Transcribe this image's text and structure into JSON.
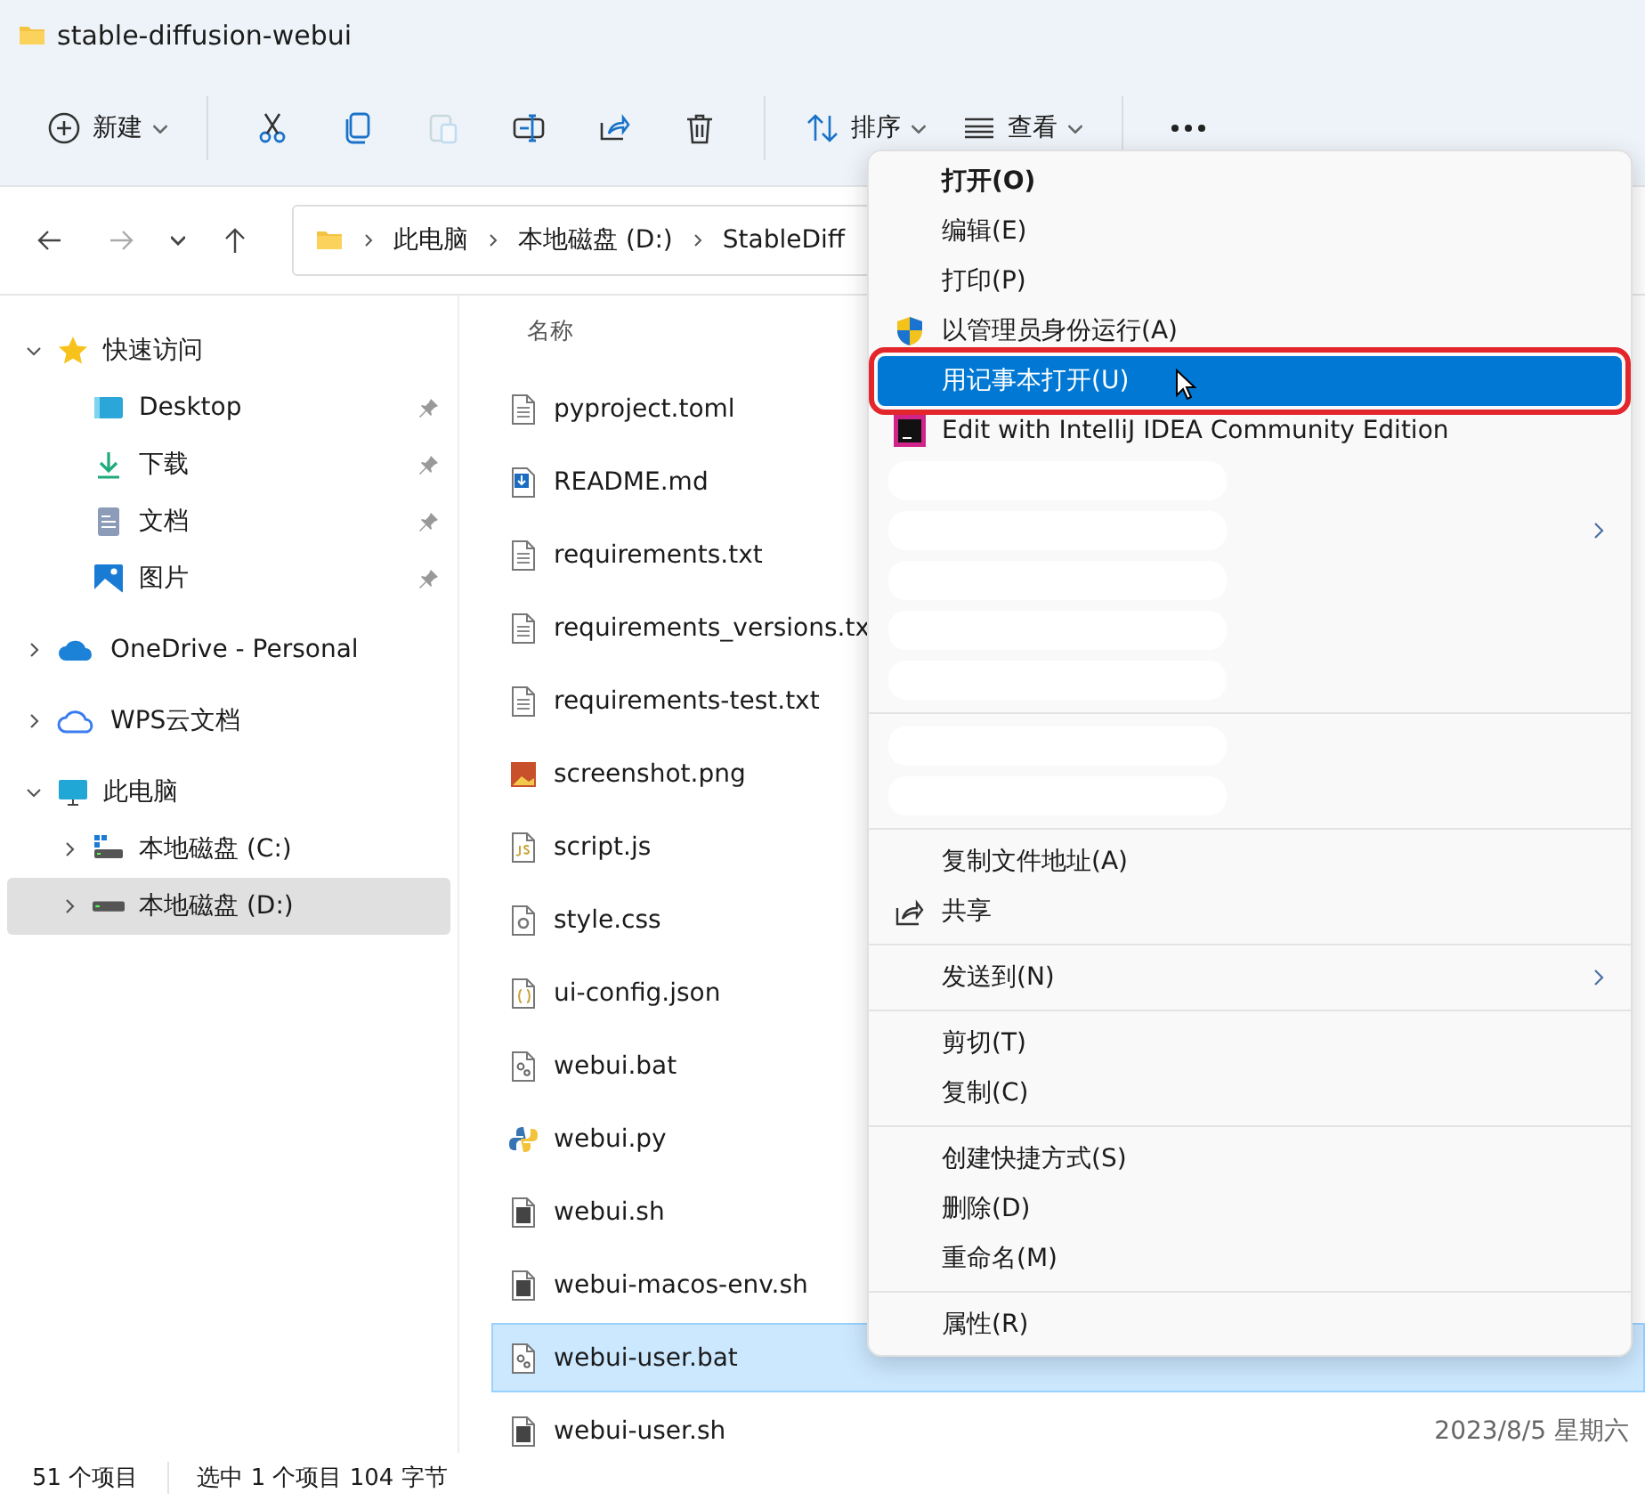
{
  "window": {
    "title": "stable-diffusion-webui"
  },
  "toolbar": {
    "items": [
      {
        "kind": "new",
        "label": "新建",
        "disabled": false
      },
      {
        "kind": "cut",
        "disabled": false
      },
      {
        "kind": "copy",
        "disabled": false
      },
      {
        "kind": "paste",
        "disabled": true
      },
      {
        "kind": "rename",
        "disabled": false
      },
      {
        "kind": "share",
        "disabled": false
      },
      {
        "kind": "delete",
        "disabled": false
      },
      {
        "kind": "sort",
        "label": "排序",
        "disabled": false
      },
      {
        "kind": "view",
        "label": "查看",
        "disabled": false
      },
      {
        "kind": "more",
        "disabled": false
      }
    ]
  },
  "navigation": {
    "back_disabled": false,
    "forward_disabled": true
  },
  "address": {
    "crumbs": [
      "此电脑",
      "本地磁盘 (D:)",
      "StableDiff"
    ]
  },
  "sidebar": {
    "items": [
      {
        "label": "快速访问",
        "kind": "star",
        "expanded": true,
        "selected": false,
        "children": [
          {
            "label": "Desktop",
            "kind": "desktop",
            "pinned": true,
            "selected": false
          },
          {
            "label": "下载",
            "kind": "download",
            "pinned": true,
            "selected": false
          },
          {
            "label": "文档",
            "kind": "document",
            "pinned": true,
            "selected": false
          },
          {
            "label": "图片",
            "kind": "pictures",
            "pinned": true,
            "selected": false
          }
        ]
      },
      {
        "label": "OneDrive - Personal",
        "kind": "onedrive",
        "expanded": false,
        "selected": false
      },
      {
        "label": "WPS云文档",
        "kind": "cloud",
        "expanded": false,
        "selected": false
      },
      {
        "label": "此电脑",
        "kind": "pc",
        "expanded": true,
        "selected": false,
        "children": [
          {
            "label": "本地磁盘 (C:)",
            "kind": "windrive",
            "expanded": false,
            "selected": false
          },
          {
            "label": "本地磁盘 (D:)",
            "kind": "drive",
            "expanded": false,
            "selected": true
          }
        ]
      }
    ]
  },
  "file_list": {
    "column": "名称",
    "rows": [
      {
        "name": "pyproject.toml",
        "kind": "text",
        "selected": false
      },
      {
        "name": "README.md",
        "kind": "markdown",
        "selected": false
      },
      {
        "name": "requirements.txt",
        "kind": "text",
        "selected": false
      },
      {
        "name": "requirements_versions.tx",
        "kind": "text",
        "selected": false
      },
      {
        "name": "requirements-test.txt",
        "kind": "text",
        "selected": false
      },
      {
        "name": "screenshot.png",
        "kind": "image",
        "selected": false
      },
      {
        "name": "script.js",
        "kind": "js",
        "selected": false
      },
      {
        "name": "style.css",
        "kind": "css",
        "selected": false
      },
      {
        "name": "ui-config.json",
        "kind": "json",
        "selected": false
      },
      {
        "name": "webui.bat",
        "kind": "bat",
        "selected": false
      },
      {
        "name": "webui.py",
        "kind": "python",
        "selected": false
      },
      {
        "name": "webui.sh",
        "kind": "shell",
        "selected": false
      },
      {
        "name": "webui-macos-env.sh",
        "kind": "shell",
        "selected": false
      },
      {
        "name": "webui-user.bat",
        "kind": "bat",
        "selected": true
      },
      {
        "name": "webui-user.sh",
        "kind": "shell",
        "selected": false,
        "date": "2023/8/5 星期六"
      }
    ]
  },
  "context_menu": {
    "groups": [
      {
        "items": [
          {
            "kind": "item",
            "label": "打开(O)",
            "bold": true,
            "selected": false,
            "outlined": false
          },
          {
            "kind": "item",
            "label": "编辑(E)",
            "selected": false,
            "outlined": false
          },
          {
            "kind": "item",
            "label": "打印(P)",
            "selected": false,
            "outlined": false
          },
          {
            "kind": "admin",
            "label": "以管理员身份运行(A)",
            "selected": false,
            "outlined": false
          },
          {
            "kind": "item",
            "label": "用记事本打开(U)",
            "selected": true,
            "outlined": true
          },
          {
            "kind": "app",
            "label": "Edit with IntelliJ IDEA Community Edition",
            "selected": false,
            "outlined": false
          },
          {
            "kind": "redacted"
          },
          {
            "kind": "redacted",
            "submenu": true
          },
          {
            "kind": "redacted"
          },
          {
            "kind": "redacted"
          },
          {
            "kind": "redacted"
          }
        ]
      },
      {
        "items": [
          {
            "kind": "redacted"
          },
          {
            "kind": "redacted"
          }
        ]
      },
      {
        "items": [
          {
            "kind": "item",
            "label": "复制文件地址(A)",
            "selected": false,
            "outlined": false
          },
          {
            "kind": "share",
            "label": "共享",
            "selected": false,
            "outlined": false
          }
        ]
      },
      {
        "items": [
          {
            "kind": "item",
            "label": "发送到(N)",
            "submenu": true,
            "selected": false,
            "outlined": false
          }
        ]
      },
      {
        "items": [
          {
            "kind": "item",
            "label": "剪切(T)",
            "selected": false,
            "outlined": false
          },
          {
            "kind": "item",
            "label": "复制(C)",
            "selected": false,
            "outlined": false
          }
        ]
      },
      {
        "items": [
          {
            "kind": "item",
            "label": "创建快捷方式(S)",
            "selected": false,
            "outlined": false
          },
          {
            "kind": "item",
            "label": "删除(D)",
            "selected": false,
            "outlined": false
          },
          {
            "kind": "item",
            "label": "重命名(M)",
            "selected": false,
            "outlined": false
          }
        ]
      },
      {
        "items": [
          {
            "kind": "item",
            "label": "属性(R)",
            "selected": false,
            "outlined": false
          }
        ]
      }
    ]
  },
  "status_bar": {
    "item_count": "51 个项目",
    "selection": "选中 1 个项目 104 字节"
  }
}
